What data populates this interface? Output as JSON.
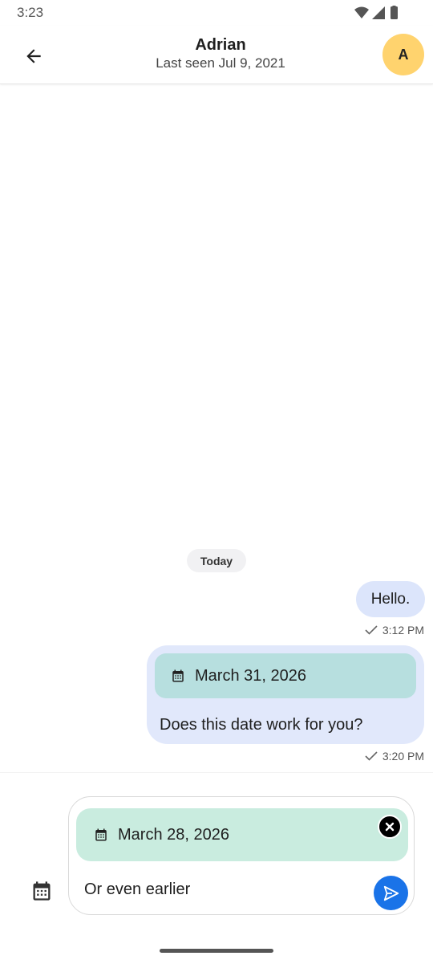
{
  "status_bar": {
    "time": "3:23",
    "icons": [
      "wifi-icon",
      "signal-icon",
      "battery-icon"
    ]
  },
  "header": {
    "name": "Adrian",
    "last_seen": "Last seen Jul 9, 2021",
    "avatar_letter": "A",
    "avatar_color": "#ffd36e"
  },
  "chat": {
    "day_label": "Today",
    "messages": [
      {
        "text": "Hello.",
        "time": "3:12 PM",
        "status": "sent"
      },
      {
        "date_attachment": "March 31, 2026",
        "text": "Does this date work for you?",
        "time": "3:20 PM",
        "status": "sent"
      }
    ]
  },
  "composer": {
    "attachment_date": "March 28, 2026",
    "input_value": "Or even earlier"
  },
  "colors": {
    "accent": "#1a73e8",
    "bubble": "#dce5fb",
    "date_card": "#b7dfdf",
    "attachment": "#c9ecdf"
  }
}
